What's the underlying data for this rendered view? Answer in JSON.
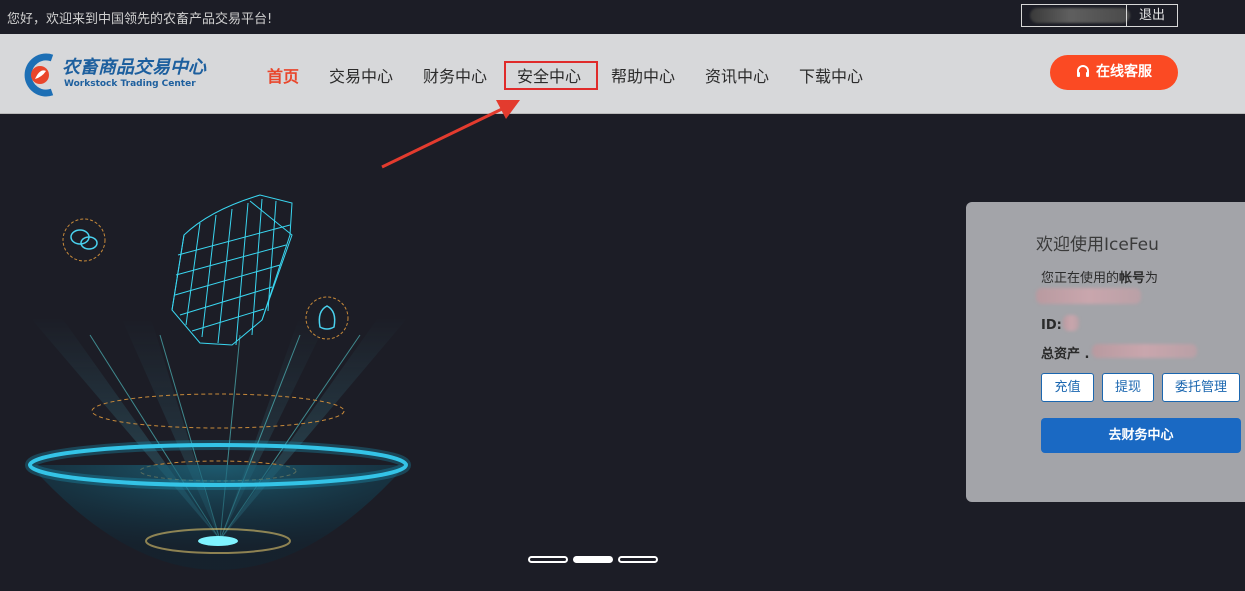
{
  "topbar": {
    "greeting": "您好，欢迎来到中国领先的农畜产品交易平台!",
    "logout_label": "退出"
  },
  "logo": {
    "name_cn": "农畜商品交易中心",
    "name_en": "Workstock Trading Center"
  },
  "nav": {
    "items": [
      {
        "label": "首页",
        "active": true
      },
      {
        "label": "交易中心",
        "active": false
      },
      {
        "label": "财务中心",
        "active": false
      },
      {
        "label": "安全中心",
        "active": false
      },
      {
        "label": "帮助中心",
        "active": false
      },
      {
        "label": "资讯中心",
        "active": false
      },
      {
        "label": "下载中心",
        "active": false
      }
    ],
    "service_label": "在线客服"
  },
  "panel": {
    "title": "欢迎使用IceFeu",
    "account_prefix": "您正在使用的",
    "account_bold": "帐号",
    "account_suffix": "为",
    "id_label": "ID:",
    "assets_label": "总资产 .",
    "buttons": {
      "recharge": "充值",
      "withdraw": "提现",
      "entrust": "委托管理"
    },
    "go_finance": "去财务中心"
  },
  "carousel": {
    "slide_count": 3,
    "active_index": 1
  },
  "colors": {
    "accent": "#e9462b",
    "service": "#fb4a23",
    "primary": "#1a69c3",
    "highlight": "#e02b2b",
    "background": "#1c1d26"
  }
}
